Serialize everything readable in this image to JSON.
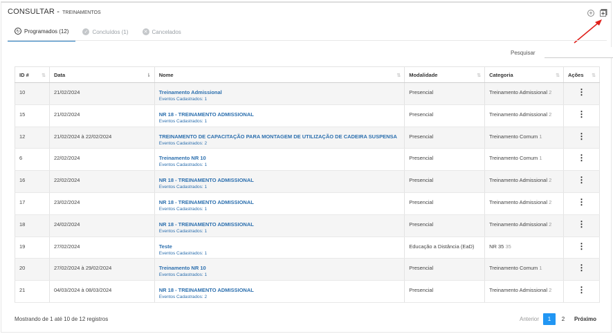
{
  "header": {
    "title": "CONSULTAR -",
    "subtitle": "TREINAMENTOS"
  },
  "tabs": [
    {
      "label": "Programados (12)",
      "icon": "refresh-icon"
    },
    {
      "label": "Concluídos (1)",
      "icon": "check-icon"
    },
    {
      "label": "Cancelados",
      "icon": "x-icon"
    }
  ],
  "search": {
    "label": "Pesquisar",
    "value": ""
  },
  "columns": [
    "ID #",
    "Data",
    "Nome",
    "Modalidade",
    "Categoria",
    "Ações"
  ],
  "rows": [
    {
      "id": "10",
      "data": "21/02/2024",
      "nome": "Treinamento Admissional",
      "eventos": "Eventos Cadastrados: 1",
      "modalidade": "Presencial",
      "categoria": "Treinamento Admissional",
      "cat_count": "2"
    },
    {
      "id": "15",
      "data": "21/02/2024",
      "nome": "NR 18 - TREINAMENTO ADMISSIONAL",
      "eventos": "Eventos Cadastrados: 1",
      "modalidade": "Presencial",
      "categoria": "Treinamento Admissional",
      "cat_count": "2"
    },
    {
      "id": "12",
      "data": "21/02/2024 à 22/02/2024",
      "nome": "TREINAMENTO DE CAPACITAÇÃO PARA MONTAGEM DE UTILIZAÇÃO DE CADEIRA SUSPENSA",
      "eventos": "Eventos Cadastrados: 2",
      "modalidade": "Presencial",
      "categoria": "Treinamento Comum",
      "cat_count": "1"
    },
    {
      "id": "6",
      "data": "22/02/2024",
      "nome": "Treinamento NR 10",
      "eventos": "Eventos Cadastrados: 1",
      "modalidade": "Presencial",
      "categoria": "Treinamento Comum",
      "cat_count": "1"
    },
    {
      "id": "16",
      "data": "22/02/2024",
      "nome": "NR 18 - TREINAMENTO ADMISSIONAL",
      "eventos": "Eventos Cadastrados: 1",
      "modalidade": "Presencial",
      "categoria": "Treinamento Admissional",
      "cat_count": "2"
    },
    {
      "id": "17",
      "data": "23/02/2024",
      "nome": "NR 18 - TREINAMENTO ADMISSIONAL",
      "eventos": "Eventos Cadastrados: 1",
      "modalidade": "Presencial",
      "categoria": "Treinamento Admissional",
      "cat_count": "2"
    },
    {
      "id": "18",
      "data": "24/02/2024",
      "nome": "NR 18 - TREINAMENTO ADMISSIONAL",
      "eventos": "Eventos Cadastrados: 1",
      "modalidade": "Presencial",
      "categoria": "Treinamento Admissional",
      "cat_count": "2"
    },
    {
      "id": "19",
      "data": "27/02/2024",
      "nome": "Teste",
      "eventos": "Eventos Cadastrados: 1",
      "modalidade": "Educação a Distância (EaD)",
      "categoria": "NR 35",
      "cat_count": "35"
    },
    {
      "id": "20",
      "data": "27/02/2024 à 29/02/2024",
      "nome": "Treinamento NR 10",
      "eventos": "Eventos Cadastrados: 1",
      "modalidade": "Presencial",
      "categoria": "Treinamento Comum",
      "cat_count": "1"
    },
    {
      "id": "21",
      "data": "04/03/2024 à 08/03/2024",
      "nome": "NR 18 - TREINAMENTO ADMISSIONAL",
      "eventos": "Eventos Cadastrados: 2",
      "modalidade": "Presencial",
      "categoria": "Treinamento Admissional",
      "cat_count": "2"
    }
  ],
  "footer": {
    "info": "Mostrando de 1 até 10 de 12 registros"
  },
  "pagination": {
    "prev": "Anterior",
    "pages": [
      "1",
      "2"
    ],
    "next": "Próximo"
  },
  "colors": {
    "accent": "#2196f3",
    "link": "#2c6fae",
    "arrow": "#e0201b"
  }
}
